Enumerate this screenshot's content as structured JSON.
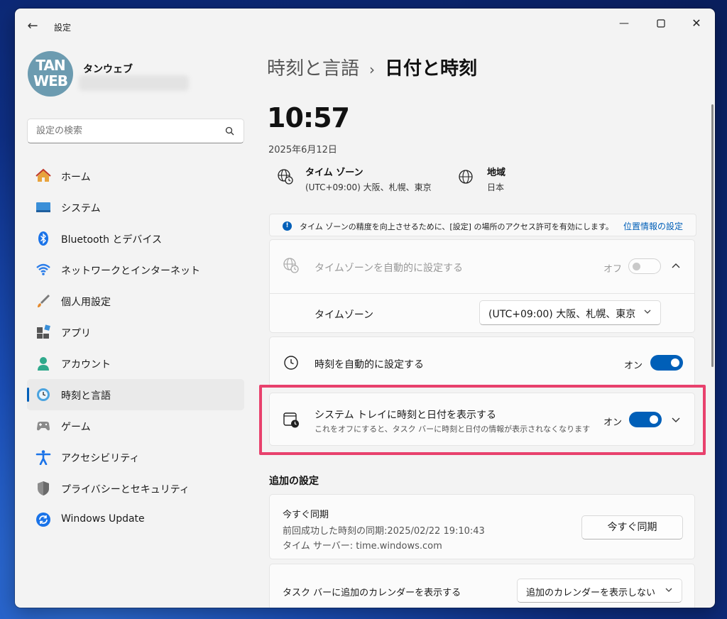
{
  "window": {
    "title": "設定"
  },
  "user": {
    "name": "タンウェブ",
    "avatar_line1": "TAN",
    "avatar_line2": "WEB"
  },
  "search": {
    "placeholder": "設定の検索"
  },
  "sidebar": {
    "items": [
      {
        "label": "ホーム",
        "icon": "home-icon"
      },
      {
        "label": "システム",
        "icon": "system-icon"
      },
      {
        "label": "Bluetooth とデバイス",
        "icon": "bluetooth-icon"
      },
      {
        "label": "ネットワークとインターネット",
        "icon": "wifi-icon"
      },
      {
        "label": "個人用設定",
        "icon": "brush-icon"
      },
      {
        "label": "アプリ",
        "icon": "apps-icon"
      },
      {
        "label": "アカウント",
        "icon": "account-icon"
      },
      {
        "label": "時刻と言語",
        "icon": "time-language-icon",
        "active": true
      },
      {
        "label": "ゲーム",
        "icon": "gamepad-icon"
      },
      {
        "label": "アクセシビリティ",
        "icon": "accessibility-icon"
      },
      {
        "label": "プライバシーとセキュリティ",
        "icon": "shield-icon"
      },
      {
        "label": "Windows Update",
        "icon": "update-icon"
      }
    ]
  },
  "header": {
    "parent": "時刻と言語",
    "separator": "›",
    "current": "日付と時刻"
  },
  "clock": {
    "time": "10:57",
    "date": "2025年6月12日"
  },
  "timezone_info": {
    "title": "タイム ゾーン",
    "value": "(UTC+09:00) 大阪、札幌、東京"
  },
  "region_info": {
    "title": "地域",
    "value": "日本"
  },
  "banner": {
    "text": "タイム ゾーンの精度を向上させるために、[設定] の場所のアクセス許可を有効にします。",
    "link": "位置情報の設定"
  },
  "settings": {
    "auto_timezone": {
      "label": "タイムゾーンを自動的に設定する",
      "state": "オフ",
      "on": false
    },
    "timezone": {
      "label": "タイムゾーン",
      "value": "(UTC+09:00) 大阪、札幌、東京"
    },
    "auto_time": {
      "label": "時刻を自動的に設定する",
      "state": "オン",
      "on": true
    },
    "tray": {
      "label": "システム トレイに時刻と日付を表示する",
      "sub": "これをオフにすると、タスク バーに時刻と日付の情報が表示されなくなります",
      "state": "オン",
      "on": true
    }
  },
  "additional": {
    "heading": "追加の設定",
    "sync": {
      "title": "今すぐ同期",
      "last": "前回成功した時刻の同期:2025/02/22 19:10:43",
      "server": "タイム サーバー: time.windows.com",
      "button": "今すぐ同期"
    },
    "calendar": {
      "label": "タスク バーに追加のカレンダーを表示する",
      "value": "追加のカレンダーを表示しない"
    }
  },
  "colors": {
    "accent": "#005fb8",
    "highlight": "#e8416d"
  }
}
